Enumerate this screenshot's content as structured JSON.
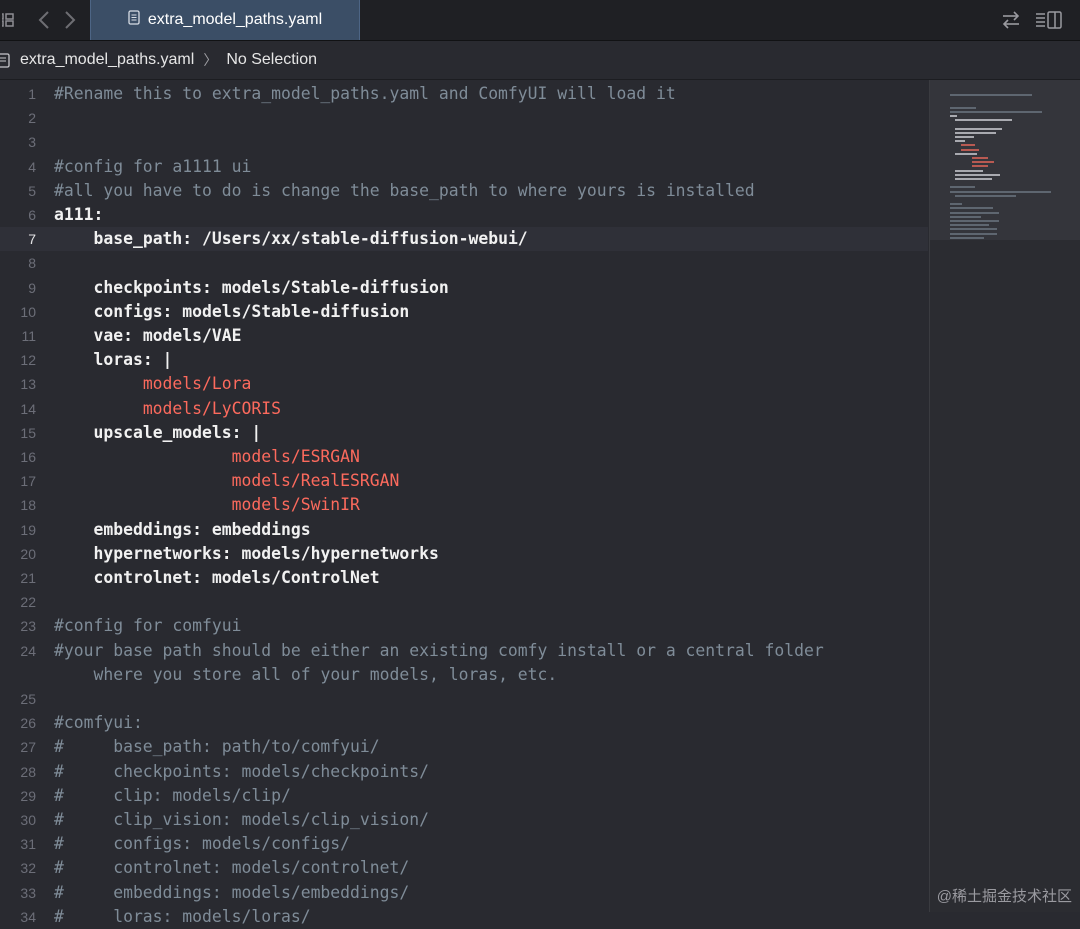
{
  "tab": {
    "title": "extra_model_paths.yaml"
  },
  "breadcrumb": {
    "file": "extra_model_paths.yaml",
    "selection": "No Selection"
  },
  "icons": {
    "grid": "grid-icon",
    "back": "chevron-left-icon",
    "forward": "chevron-right-icon",
    "file": "document-icon",
    "swap": "swap-arrows-icon",
    "layout": "editor-layout-icon"
  },
  "editor": {
    "current_line": 7,
    "lines": [
      {
        "n": "1",
        "indent": "",
        "segments": [
          {
            "t": "#Rename this to extra_model_paths.yaml and ComfyUI will load it",
            "k": "comment"
          }
        ]
      },
      {
        "n": "2",
        "indent": "",
        "segments": []
      },
      {
        "n": "3",
        "indent": "",
        "segments": []
      },
      {
        "n": "4",
        "indent": "",
        "segments": [
          {
            "t": "#config for a1111 ui",
            "k": "comment"
          }
        ]
      },
      {
        "n": "5",
        "indent": "",
        "segments": [
          {
            "t": "#all you have to do is change the base_path to where yours is installed",
            "k": "comment"
          }
        ]
      },
      {
        "n": "6",
        "indent": "",
        "segments": [
          {
            "t": "a111:",
            "k": "key"
          }
        ]
      },
      {
        "n": "7",
        "indent": "    ",
        "segments": [
          {
            "t": "base_path: /Users/xx/stable-diffusion-webui/",
            "k": "key"
          }
        ]
      },
      {
        "n": "8",
        "indent": "",
        "segments": []
      },
      {
        "n": "9",
        "indent": "    ",
        "segments": [
          {
            "t": "checkpoints: models/Stable-diffusion",
            "k": "key"
          }
        ]
      },
      {
        "n": "10",
        "indent": "    ",
        "segments": [
          {
            "t": "configs: models/Stable-diffusion",
            "k": "key"
          }
        ]
      },
      {
        "n": "11",
        "indent": "    ",
        "segments": [
          {
            "t": "vae: models/VAE",
            "k": "key"
          }
        ]
      },
      {
        "n": "12",
        "indent": "    ",
        "segments": [
          {
            "t": "loras: |",
            "k": "key"
          }
        ]
      },
      {
        "n": "13",
        "indent": "         ",
        "segments": [
          {
            "t": "models/Lora",
            "k": "str"
          }
        ]
      },
      {
        "n": "14",
        "indent": "         ",
        "segments": [
          {
            "t": "models/LyCORIS",
            "k": "str"
          }
        ]
      },
      {
        "n": "15",
        "indent": "    ",
        "segments": [
          {
            "t": "upscale_models: |",
            "k": "key"
          }
        ]
      },
      {
        "n": "16",
        "indent": "                  ",
        "segments": [
          {
            "t": "models/ESRGAN",
            "k": "str"
          }
        ]
      },
      {
        "n": "17",
        "indent": "                  ",
        "segments": [
          {
            "t": "models/RealESRGAN",
            "k": "str"
          }
        ]
      },
      {
        "n": "18",
        "indent": "                  ",
        "segments": [
          {
            "t": "models/SwinIR",
            "k": "str"
          }
        ]
      },
      {
        "n": "19",
        "indent": "    ",
        "segments": [
          {
            "t": "embeddings: embeddings",
            "k": "key"
          }
        ]
      },
      {
        "n": "20",
        "indent": "    ",
        "segments": [
          {
            "t": "hypernetworks: models/hypernetworks",
            "k": "key"
          }
        ]
      },
      {
        "n": "21",
        "indent": "    ",
        "segments": [
          {
            "t": "controlnet: models/ControlNet",
            "k": "key"
          }
        ]
      },
      {
        "n": "22",
        "indent": "",
        "segments": []
      },
      {
        "n": "23",
        "indent": "",
        "segments": [
          {
            "t": "#config for comfyui",
            "k": "comment"
          }
        ]
      },
      {
        "n": "24",
        "indent": "",
        "segments": [
          {
            "t": "#your base path should be either an existing comfy install or a central folder",
            "k": "comment"
          }
        ]
      },
      {
        "n": "",
        "indent": "    ",
        "segments": [
          {
            "t": "where you store all of your models, loras, etc.",
            "k": "comment"
          }
        ]
      },
      {
        "n": "25",
        "indent": "",
        "segments": []
      },
      {
        "n": "26",
        "indent": "",
        "segments": [
          {
            "t": "#comfyui:",
            "k": "comment"
          }
        ]
      },
      {
        "n": "27",
        "indent": "",
        "segments": [
          {
            "t": "#     base_path: path/to/comfyui/",
            "k": "comment"
          }
        ]
      },
      {
        "n": "28",
        "indent": "",
        "segments": [
          {
            "t": "#     checkpoints: models/checkpoints/",
            "k": "comment"
          }
        ]
      },
      {
        "n": "29",
        "indent": "",
        "segments": [
          {
            "t": "#     clip: models/clip/",
            "k": "comment"
          }
        ]
      },
      {
        "n": "30",
        "indent": "",
        "segments": [
          {
            "t": "#     clip_vision: models/clip_vision/",
            "k": "comment"
          }
        ]
      },
      {
        "n": "31",
        "indent": "",
        "segments": [
          {
            "t": "#     configs: models/configs/",
            "k": "comment"
          }
        ]
      },
      {
        "n": "32",
        "indent": "",
        "segments": [
          {
            "t": "#     controlnet: models/controlnet/",
            "k": "comment"
          }
        ]
      },
      {
        "n": "33",
        "indent": "",
        "segments": [
          {
            "t": "#     embeddings: models/embeddings/",
            "k": "comment"
          }
        ]
      },
      {
        "n": "34",
        "indent": "",
        "segments": [
          {
            "t": "#     loras: models/loras/",
            "k": "comment"
          }
        ]
      }
    ]
  },
  "colors": {
    "background": "#292a30",
    "comment": "#7f8c98",
    "key": "#f1f1f1",
    "string": "#fc6a5d",
    "tab_active": "#3b4e66",
    "line_number": "#6c6e78"
  },
  "watermark": "@稀土掘金技术社区"
}
